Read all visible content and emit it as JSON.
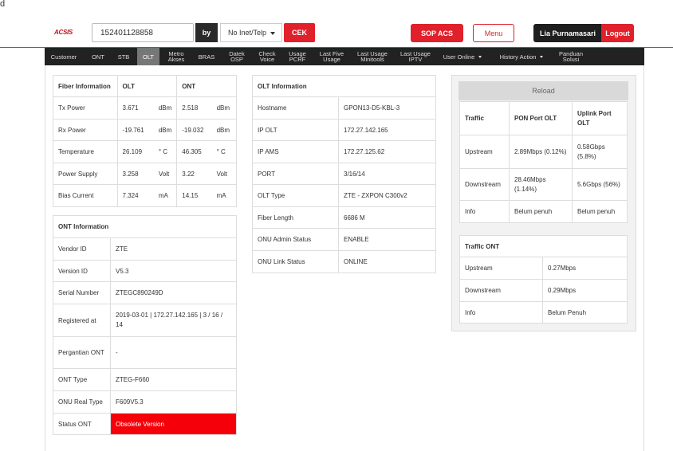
{
  "corner_glyph": "d",
  "header": {
    "logo": "ACSIS",
    "search_value": "152401128858",
    "by_label": "by",
    "filter_selected": "No Inet/Telp",
    "cek_label": "CEK",
    "sop_label": "SOP ACS",
    "menu_label": "Menu",
    "user_name": "Lia Purnamasari",
    "logout_label": "Logout"
  },
  "nav": {
    "customer": "Customer",
    "ont": "ONT",
    "stb": "STB",
    "olt": "OLT",
    "metro_1": "Metro",
    "metro_2": "Akses",
    "bras": "BRAS",
    "datek_1": "Datek",
    "datek_2": "OSP",
    "check_1": "Check",
    "check_2": "Voice",
    "usage_1": "Usage",
    "usage_2": "PCRF",
    "lastfive_1": "Last Five",
    "lastfive_2": "Usage",
    "lastmini_1": "Last Usage",
    "lastmini_2": "Minitools",
    "lastiptv_1": "Last Usage",
    "lastiptv_2": "IPTV",
    "user_online": "User Online",
    "history_action": "History Action",
    "panduan_1": "Panduan",
    "panduan_2": "Solusi"
  },
  "fiber": {
    "col_title": "Fiber Information",
    "col_olt": "OLT",
    "col_ont": "ONT",
    "rows": [
      {
        "label": "Tx Power",
        "olt": "3.671",
        "olt_unit": "dBm",
        "ont": "2.518",
        "ont_unit": "dBm"
      },
      {
        "label": "Rx Power",
        "olt": "-19.761",
        "olt_unit": "dBm",
        "ont": "-19.032",
        "ont_unit": "dBm"
      },
      {
        "label": "Temperature",
        "olt": "26.109",
        "olt_unit": "° C",
        "ont": "46.305",
        "ont_unit": "° C"
      },
      {
        "label": "Power Supply",
        "olt": "3.258",
        "olt_unit": "Volt",
        "ont": "3.22",
        "ont_unit": "Volt"
      },
      {
        "label": "Bias Current",
        "olt": "7.324",
        "olt_unit": "mA",
        "ont": "14.15",
        "ont_unit": "mA"
      }
    ]
  },
  "ont_info": {
    "title": "ONT Information",
    "rows": [
      {
        "label": "Vendor ID",
        "value": "ZTE"
      },
      {
        "label": "Version ID",
        "value": "V5.3"
      },
      {
        "label": "Serial Number",
        "value": "ZTEGC890249D"
      },
      {
        "label": "Registered at",
        "value": "2019-03-01 | 172.27.142.165 | 3 / 16 / 14"
      },
      {
        "label": "Pergantian ONT",
        "value": "-"
      },
      {
        "label": "ONT Type",
        "value": "ZTEG-F660"
      },
      {
        "label": "ONU Real Type",
        "value": "F609V5.3"
      },
      {
        "label": "Status ONT",
        "value": "Obsolete Version"
      }
    ]
  },
  "olt_info": {
    "title": "OLT Information",
    "rows": [
      {
        "label": "Hostname",
        "value": "GPON13-D5-KBL-3"
      },
      {
        "label": "IP OLT",
        "value": "172.27.142.165"
      },
      {
        "label": "IP AMS",
        "value": "172.27.125.62"
      },
      {
        "label": "PORT",
        "value": "3/16/14"
      },
      {
        "label": "OLT Type",
        "value": "ZTE - ZXPON C300v2"
      },
      {
        "label": "Fiber Length",
        "value": "6686 M"
      },
      {
        "label": "ONU Admin Status",
        "value": "ENABLE"
      },
      {
        "label": "ONU Link Status",
        "value": "ONLINE"
      }
    ]
  },
  "traffic": {
    "reload_label": "Reload",
    "col_traffic": "Traffic",
    "col_pon": "PON Port OLT",
    "col_uplink": "Uplink Port OLT",
    "rows": [
      {
        "label": "Upstream",
        "pon": "2.89Mbps (0.12%)",
        "uplink": "0.58Gbps (5.8%)"
      },
      {
        "label": "Downstream",
        "pon": "28.46Mbps (1.14%)",
        "uplink": "5.6Gbps (56%)"
      },
      {
        "label": "Info",
        "pon": "Belum penuh",
        "uplink": "Belum penuh"
      }
    ]
  },
  "traffic_ont": {
    "title": "Traffic ONT",
    "rows": [
      {
        "label": "Upstream",
        "value": "0.27Mbps"
      },
      {
        "label": "Downstream",
        "value": "0.29Mbps"
      },
      {
        "label": "Info",
        "value": "Belum Penuh"
      }
    ]
  },
  "colors": {
    "accent_red": "#e0202a",
    "nav_dark": "#222222",
    "status_obsolete": "#f5000a"
  }
}
